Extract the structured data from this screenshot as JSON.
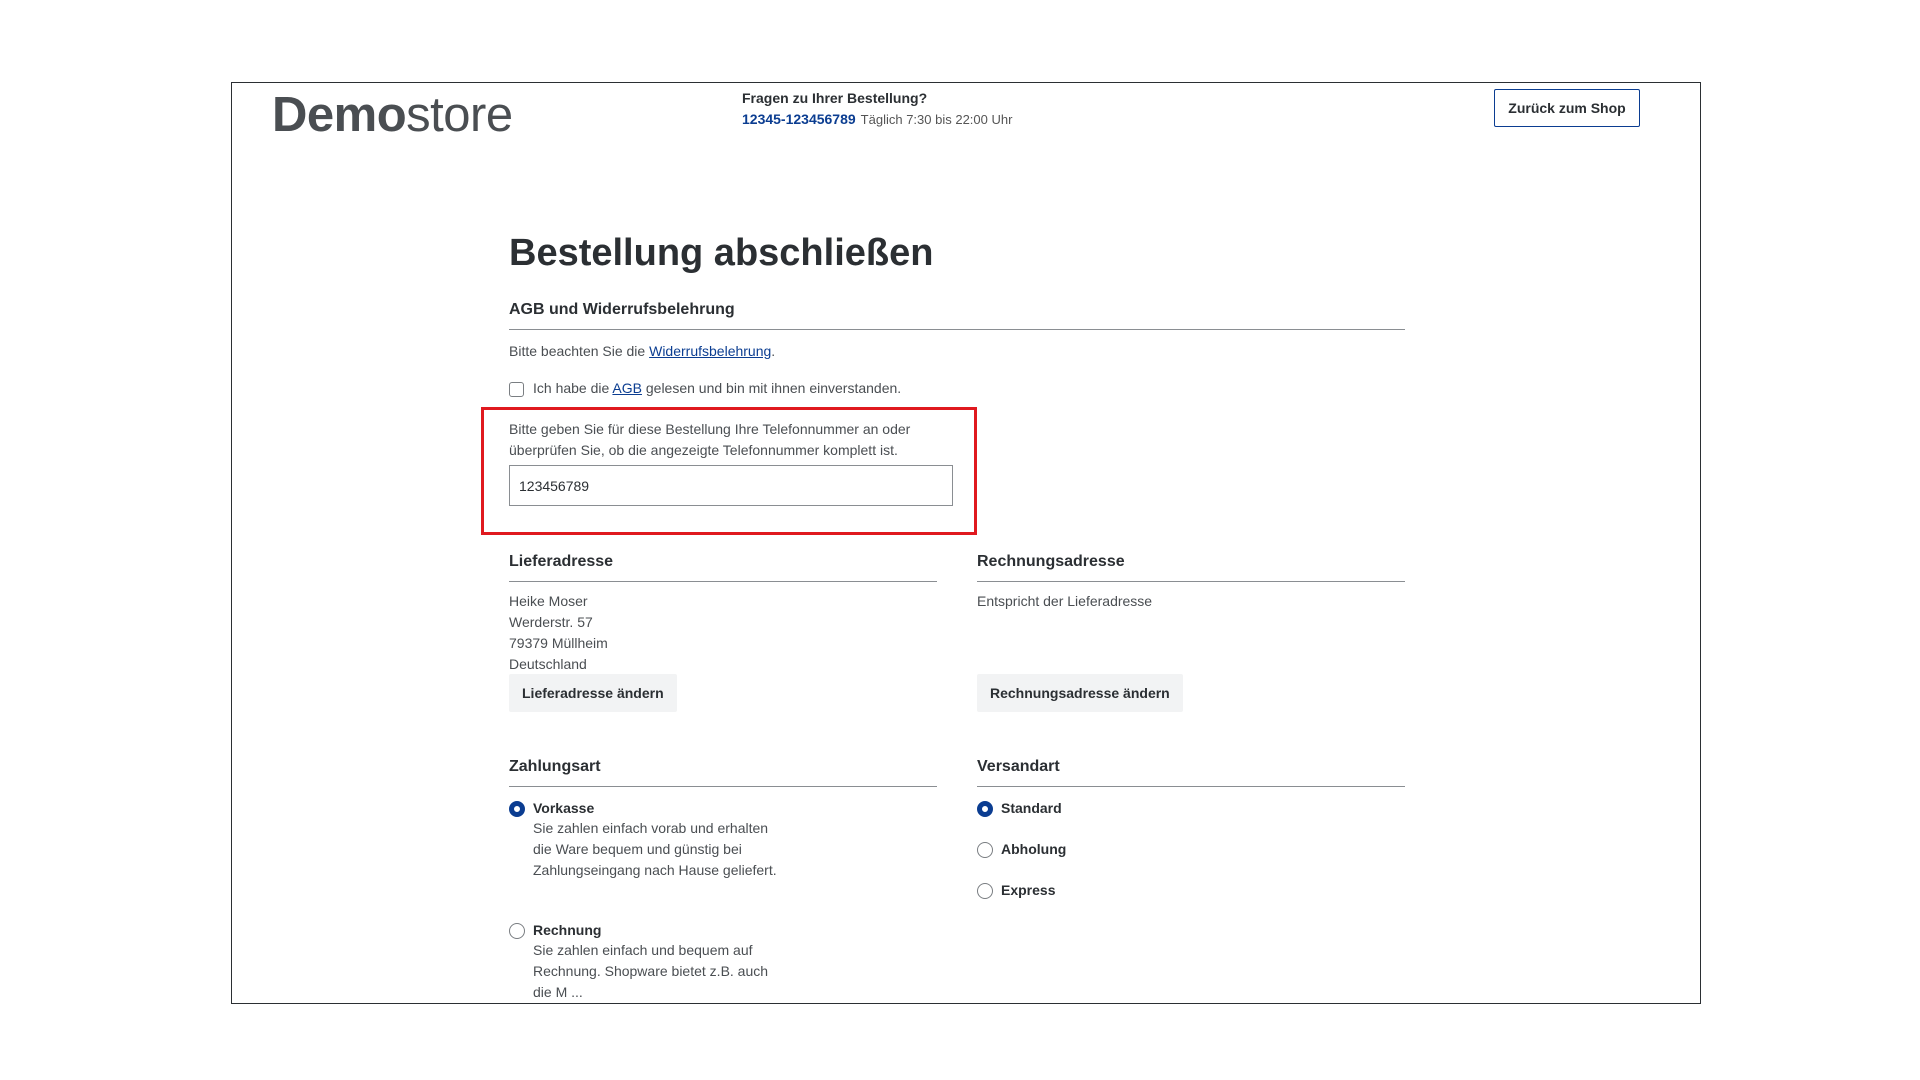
{
  "header": {
    "logo_bold": "Demo",
    "logo_light": "store",
    "contact_question": "Fragen zu Ihrer Bestellung?",
    "contact_phone": "12345-123456789",
    "contact_hours": "Täglich 7:30 bis 22:00 Uhr",
    "back_button": "Zurück zum Shop"
  },
  "page": {
    "title": "Bestellung abschließen"
  },
  "terms": {
    "section_title": "AGB und Widerrufsbelehrung",
    "notice_prefix": "Bitte beachten Sie die ",
    "notice_link": "Widerrufsbelehrung",
    "notice_suffix": ".",
    "checkbox_prefix": "Ich habe die ",
    "checkbox_link": "AGB",
    "checkbox_suffix": " gelesen und bin mit ihnen einverstanden.",
    "checkbox_checked": false
  },
  "phone": {
    "instruction_line1": "Bitte geben Sie für diese Bestellung Ihre Telefonnummer an oder",
    "instruction_line2": "überprüfen Sie, ob die angezeigte Telefonnummer komplett ist.",
    "value": "123456789"
  },
  "shipping_address": {
    "title": "Lieferadresse",
    "lines": [
      "Heike Moser",
      "Werderstr. 57",
      "79379 Müllheim",
      "Deutschland"
    ],
    "change_button": "Lieferadresse ändern"
  },
  "billing_address": {
    "title": "Rechnungsadresse",
    "text": "Entspricht der Lieferadresse",
    "change_button": "Rechnungsadresse ändern"
  },
  "payment": {
    "title": "Zahlungsart",
    "options": [
      {
        "label": "Vorkasse",
        "selected": true,
        "description": [
          "Sie zahlen einfach vorab und erhalten",
          "die Ware bequem und günstig bei",
          "Zahlungseingang nach Hause geliefert."
        ]
      },
      {
        "label": "Rechnung",
        "selected": false,
        "description": [
          "Sie zahlen einfach und bequem auf",
          "Rechnung. Shopware bietet z.B. auch",
          "die M ..."
        ]
      }
    ]
  },
  "shipping_method": {
    "title": "Versandart",
    "options": [
      {
        "label": "Standard",
        "selected": true
      },
      {
        "label": "Abholung",
        "selected": false
      },
      {
        "label": "Express",
        "selected": false
      }
    ]
  },
  "colors": {
    "accent": "#0b3d91",
    "highlight": "#e0191f",
    "text": "#2b2f33"
  }
}
